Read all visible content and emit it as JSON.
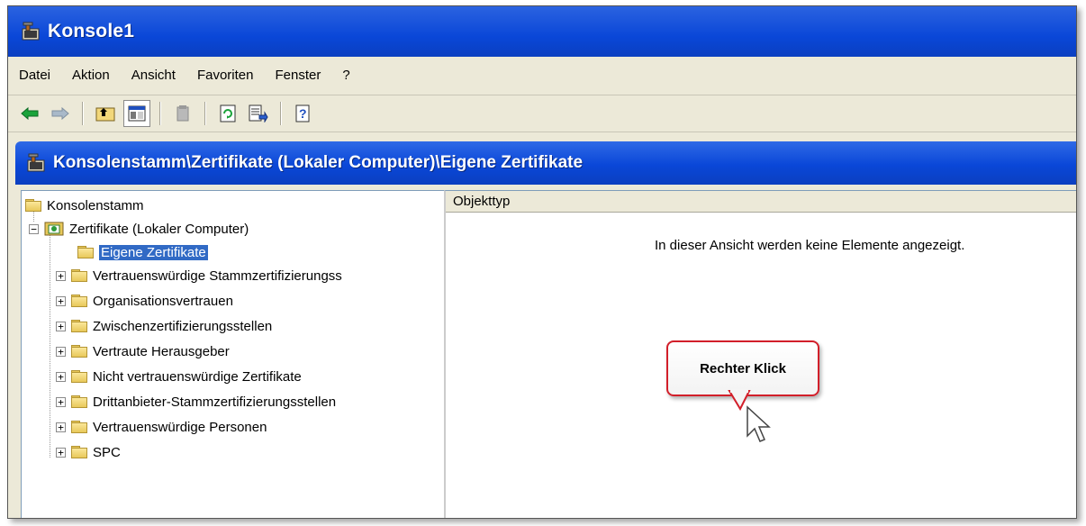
{
  "window": {
    "title": "Konsole1"
  },
  "menu": [
    "Datei",
    "Aktion",
    "Ansicht",
    "Favoriten",
    "Fenster",
    "?"
  ],
  "toolbar": {
    "buttons": [
      "back-arrow-icon",
      "forward-arrow-icon",
      "up-level-icon",
      "show-hide-tree-icon",
      "delete-icon",
      "refresh-icon",
      "export-list-icon",
      "help-icon"
    ]
  },
  "inner": {
    "title": "Konsolenstamm\\Zertifikate (Lokaler Computer)\\Eigene Zertifikate"
  },
  "tree": {
    "root": "Konsolenstamm",
    "node": "Zertifikate (Lokaler Computer)",
    "selected": "Eigene Zertifikate",
    "children": [
      "Vertrauenswürdige Stammzertifizierungss",
      "Organisationsvertrauen",
      "Zwischenzertifizierungsstellen",
      "Vertraute Herausgeber",
      "Nicht vertrauenswürdige Zertifikate",
      "Drittanbieter-Stammzertifizierungsstellen",
      "Vertrauenswürdige Personen",
      "SPC"
    ]
  },
  "list": {
    "column_header": "Objekttyp",
    "empty_message": "In dieser Ansicht werden keine Elemente angezeigt."
  },
  "callout": {
    "text": "Rechter Klick"
  },
  "colors": {
    "titlebar": "#0a47d8",
    "selection": "#316ac5",
    "callout_border": "#d21f2a"
  }
}
